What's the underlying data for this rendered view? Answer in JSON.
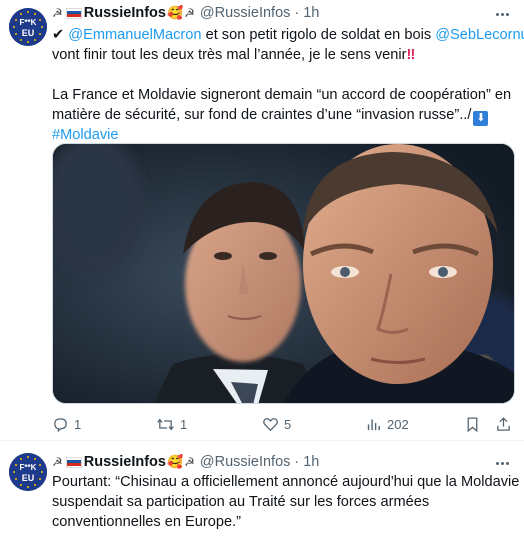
{
  "tweets": [
    {
      "prefix_glyph": "☭",
      "name": "RussieInfos",
      "face_glyph": "🥰",
      "suffix_glyph": "☭",
      "handle": "@RussieInfos",
      "dot": "·",
      "time": "1h",
      "avatar_text_top": "F**K",
      "avatar_text_bottom": "EU",
      "text": {
        "line1_check": "✔",
        "line1_mention1": "@EmmanuelMacron",
        "line1_mid": " et son petit rigolo de soldat en bois ",
        "line1_mention2": "@SebLecornu",
        "line2": "vont finir tout les deux très mal l’année, je le sens venir",
        "line2_bang": "‼",
        "line4": "La France et Moldavie signeront demain “un accord de coopération” en",
        "line5": "matière de sécurité, sur fond de craintes d’une “invasion russe”../",
        "line5_arrow": "⬇",
        "line6_hashtag": "#Moldavie"
      },
      "actions": {
        "replies": "1",
        "reposts": "1",
        "likes": "5",
        "views": "202"
      }
    },
    {
      "prefix_glyph": "☭",
      "name": "RussieInfos",
      "face_glyph": "🥰",
      "suffix_glyph": "☭",
      "handle": "@RussieInfos",
      "dot": "·",
      "time": "1h",
      "avatar_text_top": "F**K",
      "avatar_text_bottom": "EU",
      "text": {
        "line1": "Pourtant: “Chisinau a officiellement annoncé aujourd'hui que la Moldavie",
        "line2": "suspendait sa participation au Traité sur les forces armées",
        "line3": "conventionnelles en Europe.”"
      }
    }
  ],
  "colors": {
    "link": "#1d9bf0",
    "secondary_text": "#536471",
    "avatar_bg": "#1e3a8a"
  },
  "icons": [
    "reply-icon",
    "repost-icon",
    "like-icon",
    "views-icon",
    "bookmark-icon",
    "share-icon",
    "more-icon"
  ]
}
